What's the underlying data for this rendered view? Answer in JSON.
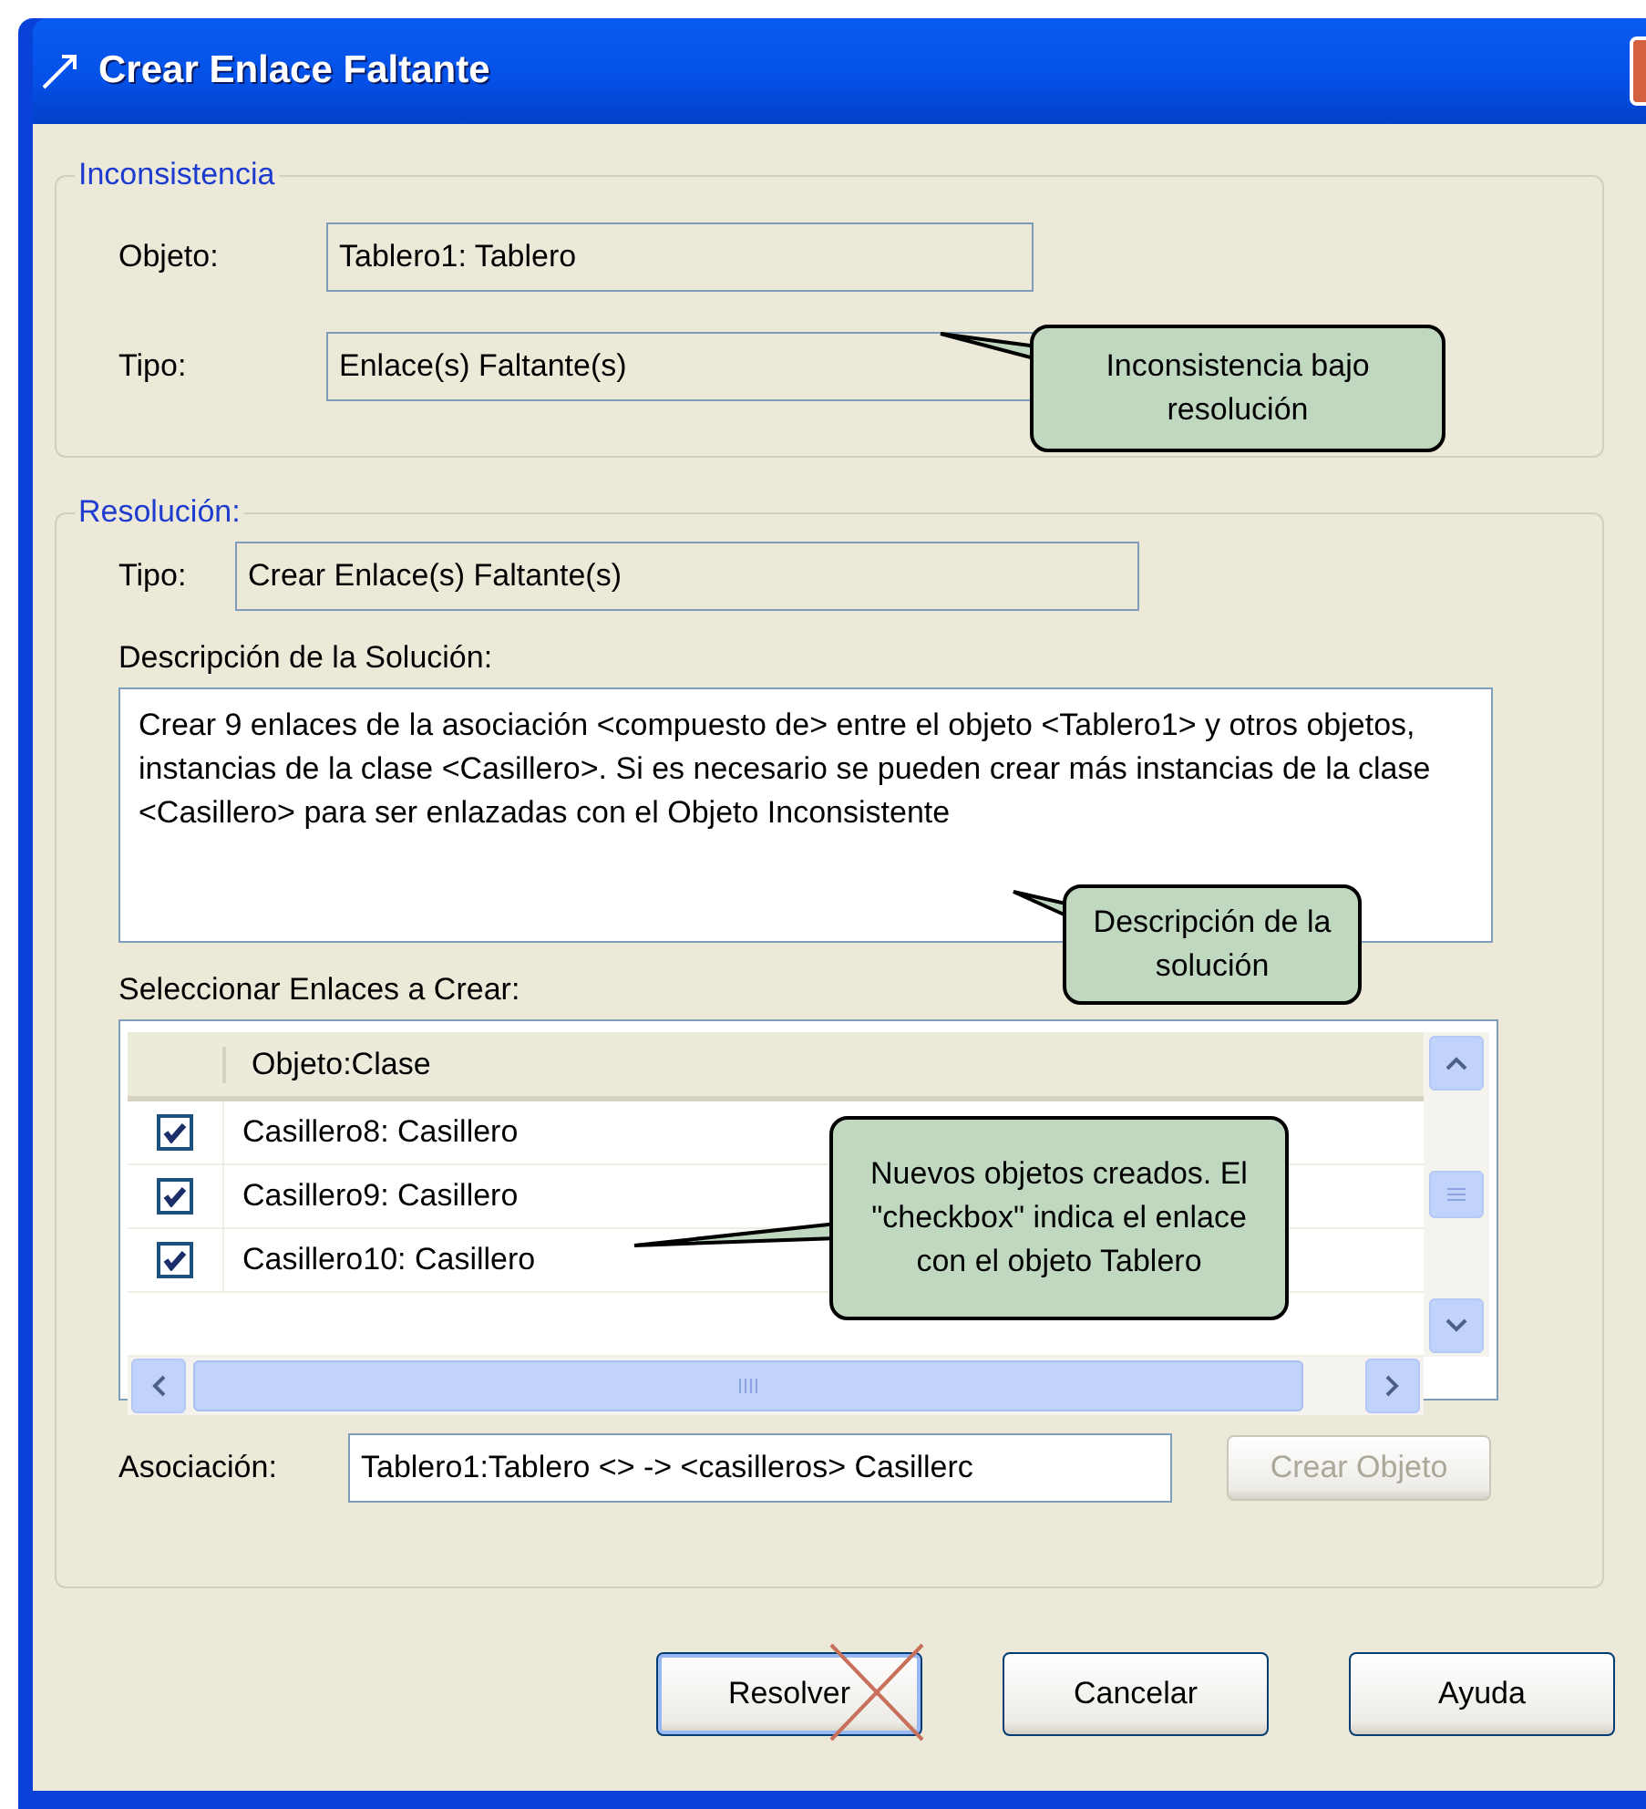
{
  "window": {
    "title": "Crear Enlace Faltante"
  },
  "inconsistency": {
    "legend": "Inconsistencia",
    "object_label": "Objeto:",
    "object_value": "Tablero1: Tablero",
    "type_label": "Tipo:",
    "type_value": "Enlace(s) Faltante(s)"
  },
  "resolution": {
    "legend": "Resolución:",
    "type_label": "Tipo:",
    "type_value": "Crear Enlace(s) Faltante(s)",
    "description_label": "Descripción de la Solución:",
    "description": "Crear 9 enlaces de la asociación <compuesto de> entre el objeto <Tablero1> y otros objetos, instancias de la clase <Casillero>. Si es necesario se pueden crear más instancias de la clase <Casillero> para ser enlazadas con el Objeto Inconsistente",
    "links_label": "Seleccionar Enlaces a Crear:",
    "table": {
      "columns": [
        "Objeto:Clase"
      ],
      "rows": [
        {
          "name": "Casillero8: Casillero",
          "checked": true
        },
        {
          "name": "Casillero9: Casillero",
          "checked": true
        },
        {
          "name": "Casillero10: Casillero",
          "checked": true
        }
      ]
    },
    "association_label": "Asociación:",
    "association_value": "Tablero1:Tablero <> -> <casilleros> Casillerc",
    "create_object": {
      "label": "Crear Objeto",
      "disabled": true
    }
  },
  "buttons": [
    {
      "label": "Resolver",
      "default": true,
      "crossed": true
    },
    {
      "label": "Cancelar",
      "default": false,
      "crossed": false
    },
    {
      "label": "Ayuda",
      "default": false,
      "crossed": false
    }
  ],
  "callouts": [
    {
      "text": "Inconsistencia bajo resolución"
    },
    {
      "text": "Descripción de la solución"
    },
    {
      "text": "Nuevos objetos creados. El \"checkbox\" indica el enlace con el objeto Tablero"
    }
  ]
}
